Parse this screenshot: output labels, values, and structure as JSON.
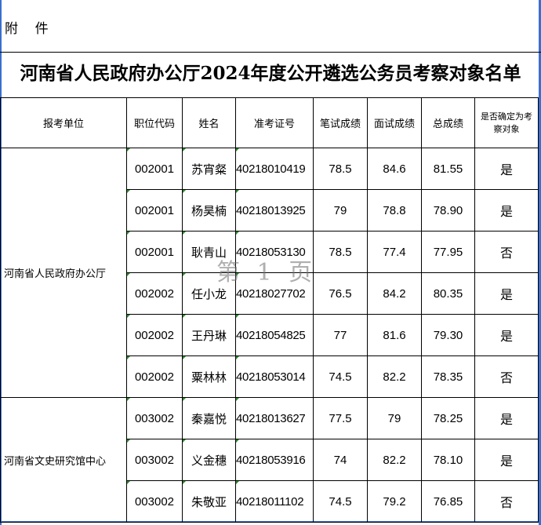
{
  "attachment_label": "附    件",
  "title": "河南省人民政府办公厅2024年度公开遴选公务员考察对象名单",
  "table": {
    "headers": [
      "报考单位",
      "职位代码",
      "姓名",
      "准考证号",
      "笔试成绩",
      "面试成绩",
      "总成绩",
      "是否确定为考察对象"
    ],
    "groups": [
      {
        "unit": "河南省人民政府办公厅",
        "rows": [
          {
            "code": "002001",
            "name": "苏宵粲",
            "ticket": "40218010419",
            "written": "78.5",
            "interview": "84.6",
            "total": "81.55",
            "selected": "是"
          },
          {
            "code": "002001",
            "name": "杨昊楠",
            "ticket": "40218013925",
            "written": "79",
            "interview": "78.8",
            "total": "78.90",
            "selected": "是"
          },
          {
            "code": "002001",
            "name": "耿青山",
            "ticket": "40218053130",
            "written": "78.5",
            "interview": "77.4",
            "total": "77.95",
            "selected": "否"
          },
          {
            "code": "002002",
            "name": "任小龙",
            "ticket": "40218027702",
            "written": "76.5",
            "interview": "84.2",
            "total": "80.35",
            "selected": "是"
          },
          {
            "code": "002002",
            "name": "王丹琳",
            "ticket": "40218054825",
            "written": "77",
            "interview": "81.6",
            "total": "79.30",
            "selected": "是"
          },
          {
            "code": "002002",
            "name": "粟林林",
            "ticket": "40218053014",
            "written": "74.5",
            "interview": "82.2",
            "total": "78.35",
            "selected": "否"
          }
        ]
      },
      {
        "unit": "河南省文史研究馆中心",
        "rows": [
          {
            "code": "003002",
            "name": "秦嘉悦",
            "ticket": "40218013627",
            "written": "77.5",
            "interview": "79",
            "total": "78.25",
            "selected": "是"
          },
          {
            "code": "003002",
            "name": "义金穗",
            "ticket": "40218053916",
            "written": "74",
            "interview": "82.2",
            "total": "78.10",
            "selected": "是"
          },
          {
            "code": "003002",
            "name": "朱敬亚",
            "ticket": "40218011102",
            "written": "74.5",
            "interview": "79.2",
            "total": "76.85",
            "selected": "否"
          }
        ]
      }
    ]
  },
  "watermark": "第 1 页",
  "colors": {
    "frame": "#3a6fd0",
    "cell_marker": "#2e8b2e"
  }
}
